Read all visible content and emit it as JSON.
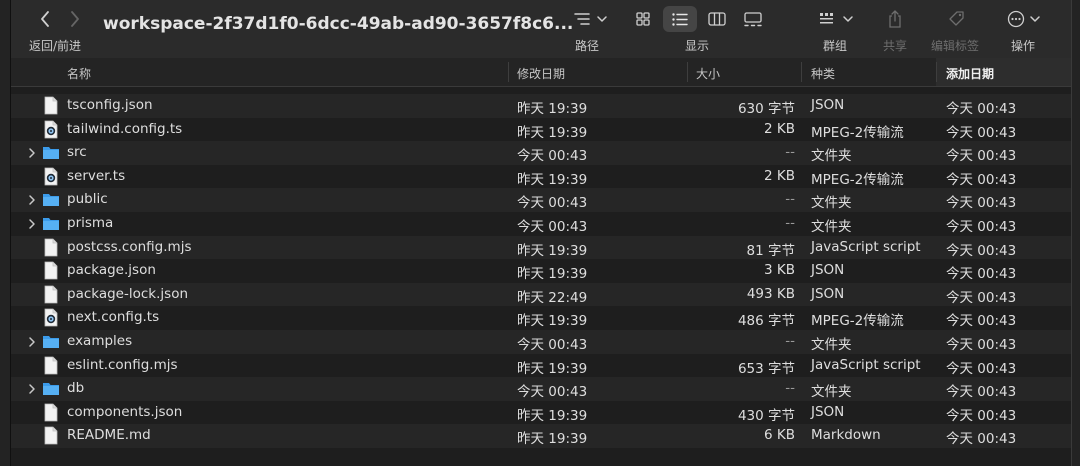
{
  "toolbar": {
    "title": "workspace-2f37d1f0-6dcc-49ab-ad90-3657f8c6...",
    "nav_label": "返回/前进",
    "path_label": "路径",
    "view_label": "显示",
    "group_label": "群组",
    "share_label": "共享",
    "edit_tags_label": "编辑标签",
    "action_label": "操作"
  },
  "columns": {
    "name": "名称",
    "date_modified": "修改日期",
    "size": "大小",
    "kind": "种类",
    "date_added": "添加日期"
  },
  "sorted_column": "date_added",
  "files": [
    {
      "name": "tsconfig.json",
      "icon": "document-icon",
      "modified": "昨天 19:39",
      "size": "630 字节",
      "kind": "JSON",
      "added": "今天 00:43"
    },
    {
      "name": "tailwind.config.ts",
      "icon": "mpeg-ts-icon",
      "modified": "昨天 19:39",
      "size": "2 KB",
      "kind": "MPEG-2传输流",
      "added": "今天 00:43"
    },
    {
      "name": "src",
      "icon": "folder-icon",
      "modified": "今天 00:43",
      "size": "--",
      "kind": "文件夹",
      "added": "今天 00:43"
    },
    {
      "name": "server.ts",
      "icon": "mpeg-ts-icon",
      "modified": "昨天 19:39",
      "size": "2 KB",
      "kind": "MPEG-2传输流",
      "added": "今天 00:43"
    },
    {
      "name": "public",
      "icon": "folder-icon",
      "modified": "今天 00:43",
      "size": "--",
      "kind": "文件夹",
      "added": "今天 00:43"
    },
    {
      "name": "prisma",
      "icon": "folder-icon",
      "modified": "今天 00:43",
      "size": "--",
      "kind": "文件夹",
      "added": "今天 00:43"
    },
    {
      "name": "postcss.config.mjs",
      "icon": "document-icon",
      "modified": "昨天 19:39",
      "size": "81 字节",
      "kind": "JavaScript script",
      "added": "今天 00:43"
    },
    {
      "name": "package.json",
      "icon": "document-icon",
      "modified": "昨天 19:39",
      "size": "3 KB",
      "kind": "JSON",
      "added": "今天 00:43"
    },
    {
      "name": "package-lock.json",
      "icon": "document-icon",
      "modified": "昨天 22:49",
      "size": "493 KB",
      "kind": "JSON",
      "added": "今天 00:43"
    },
    {
      "name": "next.config.ts",
      "icon": "mpeg-ts-icon",
      "modified": "昨天 19:39",
      "size": "486 字节",
      "kind": "MPEG-2传输流",
      "added": "今天 00:43"
    },
    {
      "name": "examples",
      "icon": "folder-icon",
      "modified": "今天 00:43",
      "size": "--",
      "kind": "文件夹",
      "added": "今天 00:43"
    },
    {
      "name": "eslint.config.mjs",
      "icon": "document-icon",
      "modified": "昨天 19:39",
      "size": "653 字节",
      "kind": "JavaScript script",
      "added": "今天 00:43"
    },
    {
      "name": "db",
      "icon": "folder-icon",
      "modified": "今天 00:43",
      "size": "--",
      "kind": "文件夹",
      "added": "今天 00:43"
    },
    {
      "name": "components.json",
      "icon": "document-icon",
      "modified": "昨天 19:39",
      "size": "430 字节",
      "kind": "JSON",
      "added": "今天 00:43"
    },
    {
      "name": "README.md",
      "icon": "document-icon",
      "modified": "昨天 19:39",
      "size": "6 KB",
      "kind": "Markdown",
      "added": "今天 00:43"
    }
  ],
  "colors": {
    "folder": "#3b9bea",
    "background": "#1e1e1e",
    "row_alt": "#262626",
    "toolbar": "#2b2b2b"
  }
}
